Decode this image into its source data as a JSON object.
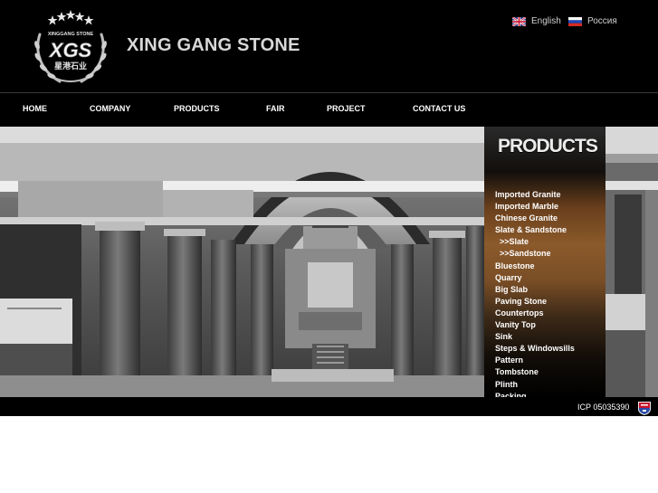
{
  "brand": {
    "title": "XING GANG STONE",
    "logo_text": "XGS",
    "logo_subtext": "XINGGANG STONE",
    "logo_chinese": "星港石业"
  },
  "languages": [
    {
      "label": "English",
      "flag": "uk-flag-icon"
    },
    {
      "label": "Россия",
      "flag": "russia-flag-icon"
    }
  ],
  "nav": {
    "items": [
      "HOME",
      "COMPANY",
      "PRODUCTS",
      "FAIR",
      "PROJECT",
      "CONTACT US"
    ]
  },
  "products": {
    "title": "PRODUCTS",
    "items": [
      "Imported Granite",
      "Imported Marble",
      "Chinese Granite",
      "Slate & Sandstone",
      ">>Slate",
      ">>Sandstone",
      "Bluestone",
      "Quarry",
      "Big Slab",
      "Paving Stone",
      "Countertops",
      "Vanity Top",
      "Sink",
      "Steps & Windowsills",
      "Pattern",
      "Tombstone",
      "Plinth",
      "Packing"
    ]
  },
  "footer": {
    "icp": "ICP 05035390"
  },
  "colors": {
    "background": "#000000",
    "nav_text": "#ffffff",
    "panel_accent": "#8b5a2b"
  }
}
